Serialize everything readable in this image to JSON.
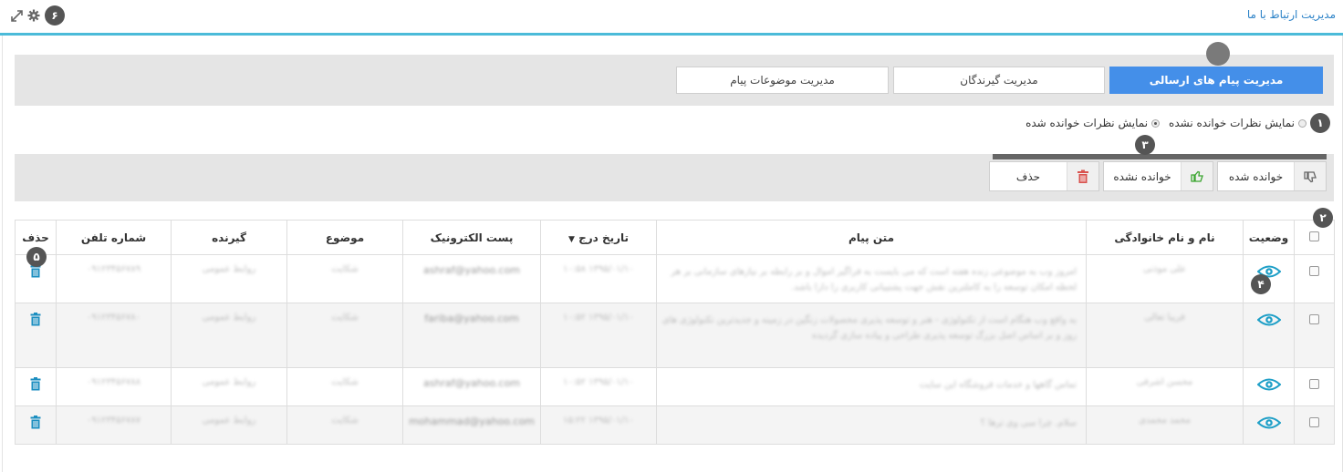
{
  "header": {
    "title": "مدیریت ارتباط با ما",
    "badge": "۶",
    "icons": [
      "expand-icon",
      "gear-icon"
    ]
  },
  "tabs": [
    {
      "label": "مدیریت پیام های ارسالی",
      "active": true
    },
    {
      "label": "مدیریت گیرندگان",
      "active": false
    },
    {
      "label": "مدیریت موضوعات پیام",
      "active": false
    }
  ],
  "filter": {
    "badge": "۱",
    "unread_label": "نمایش نظرات خوانده نشده",
    "read_label": "نمایش نظرات خوانده شده",
    "selected": "read"
  },
  "actions": {
    "badge": "۳",
    "mark_read": "خوانده شده",
    "mark_unread": "خوانده نشده",
    "delete": "حذف"
  },
  "table": {
    "badge_header": "۲",
    "badge_status": "۴",
    "badge_delete": "۵",
    "headers": {
      "status": "وضعیت",
      "name": "نام و نام خانوادگی",
      "message": "متن پیام",
      "date": "تاریخ درج",
      "email": "پست الکترونیک",
      "subject": "موضوع",
      "recipient": "گیرنده",
      "phone": "شماره تلفن",
      "delete": "حذف"
    },
    "rows": [
      {
        "name": "علی موذنی",
        "message": "امروز وب به موضوعی زنده هفته است که می بایست به فراگیر اموال و بر رابطه بر نیازهای سازمانی بر هر لحظه امکان توسعه را به کاملترین نقش جهت پشتیبانی کاربری را دارا باشد.",
        "date": "۱۳۹۵/۰۱/۱۰ ۱۰:۵۸",
        "email": "ashraf@yahoo.com",
        "subject": "شکایت",
        "recipient": "روابط عمومی",
        "phone": "۰۹۱۲۳۴۵۶۷۸۹"
      },
      {
        "name": "فریبا تعالی",
        "message": "به واقع وب هنگام است از تکنولوژی - هنر و توسعه پذیری محصولات زنگین در زمینه و جدیدترین تکنولوژی های روز و بر اساس اصل بزرگ توسعه پذیری طراحی و پیاده سازی گردیده",
        "date": "۱۳۹۵/۰۱/۱۰ ۱۰:۵۲",
        "email": "fariba@yahoo.com",
        "subject": "شکایت",
        "recipient": "روابط عمومی",
        "phone": "۰۹۱۲۳۴۵۶۷۸۰"
      },
      {
        "name": "محسن اشرفی",
        "message": "تماس گاهها و خدمات فروشگاه این سایت",
        "date": "۱۳۹۵/۰۱/۱۰ ۱۰:۵۲",
        "email": "ashraf@yahoo.com",
        "subject": "شکایت",
        "recipient": "روابط عمومی",
        "phone": "۰۹۱۲۳۴۵۶۷۸۸"
      },
      {
        "name": "محمد محمدی",
        "message": "سلام. چرا سی وی ترها ؟",
        "date": "۱۳۹۵/۰۱/۱۰ ۱۵:۲۲",
        "email": "mohammad@yahoo.com",
        "subject": "شکایت",
        "recipient": "روابط عمومی",
        "phone": "۰۹۱۲۳۴۵۶۷۸۷"
      }
    ]
  },
  "colors": {
    "accent": "#4bbbd9",
    "active_tab": "#448fe9",
    "title_link": "#2d83c8",
    "eye_icon": "#1e9fc7",
    "trash_icon": "#1b8ec0",
    "thumb_up": "#3aa52f",
    "trash_red": "#d9534f"
  }
}
